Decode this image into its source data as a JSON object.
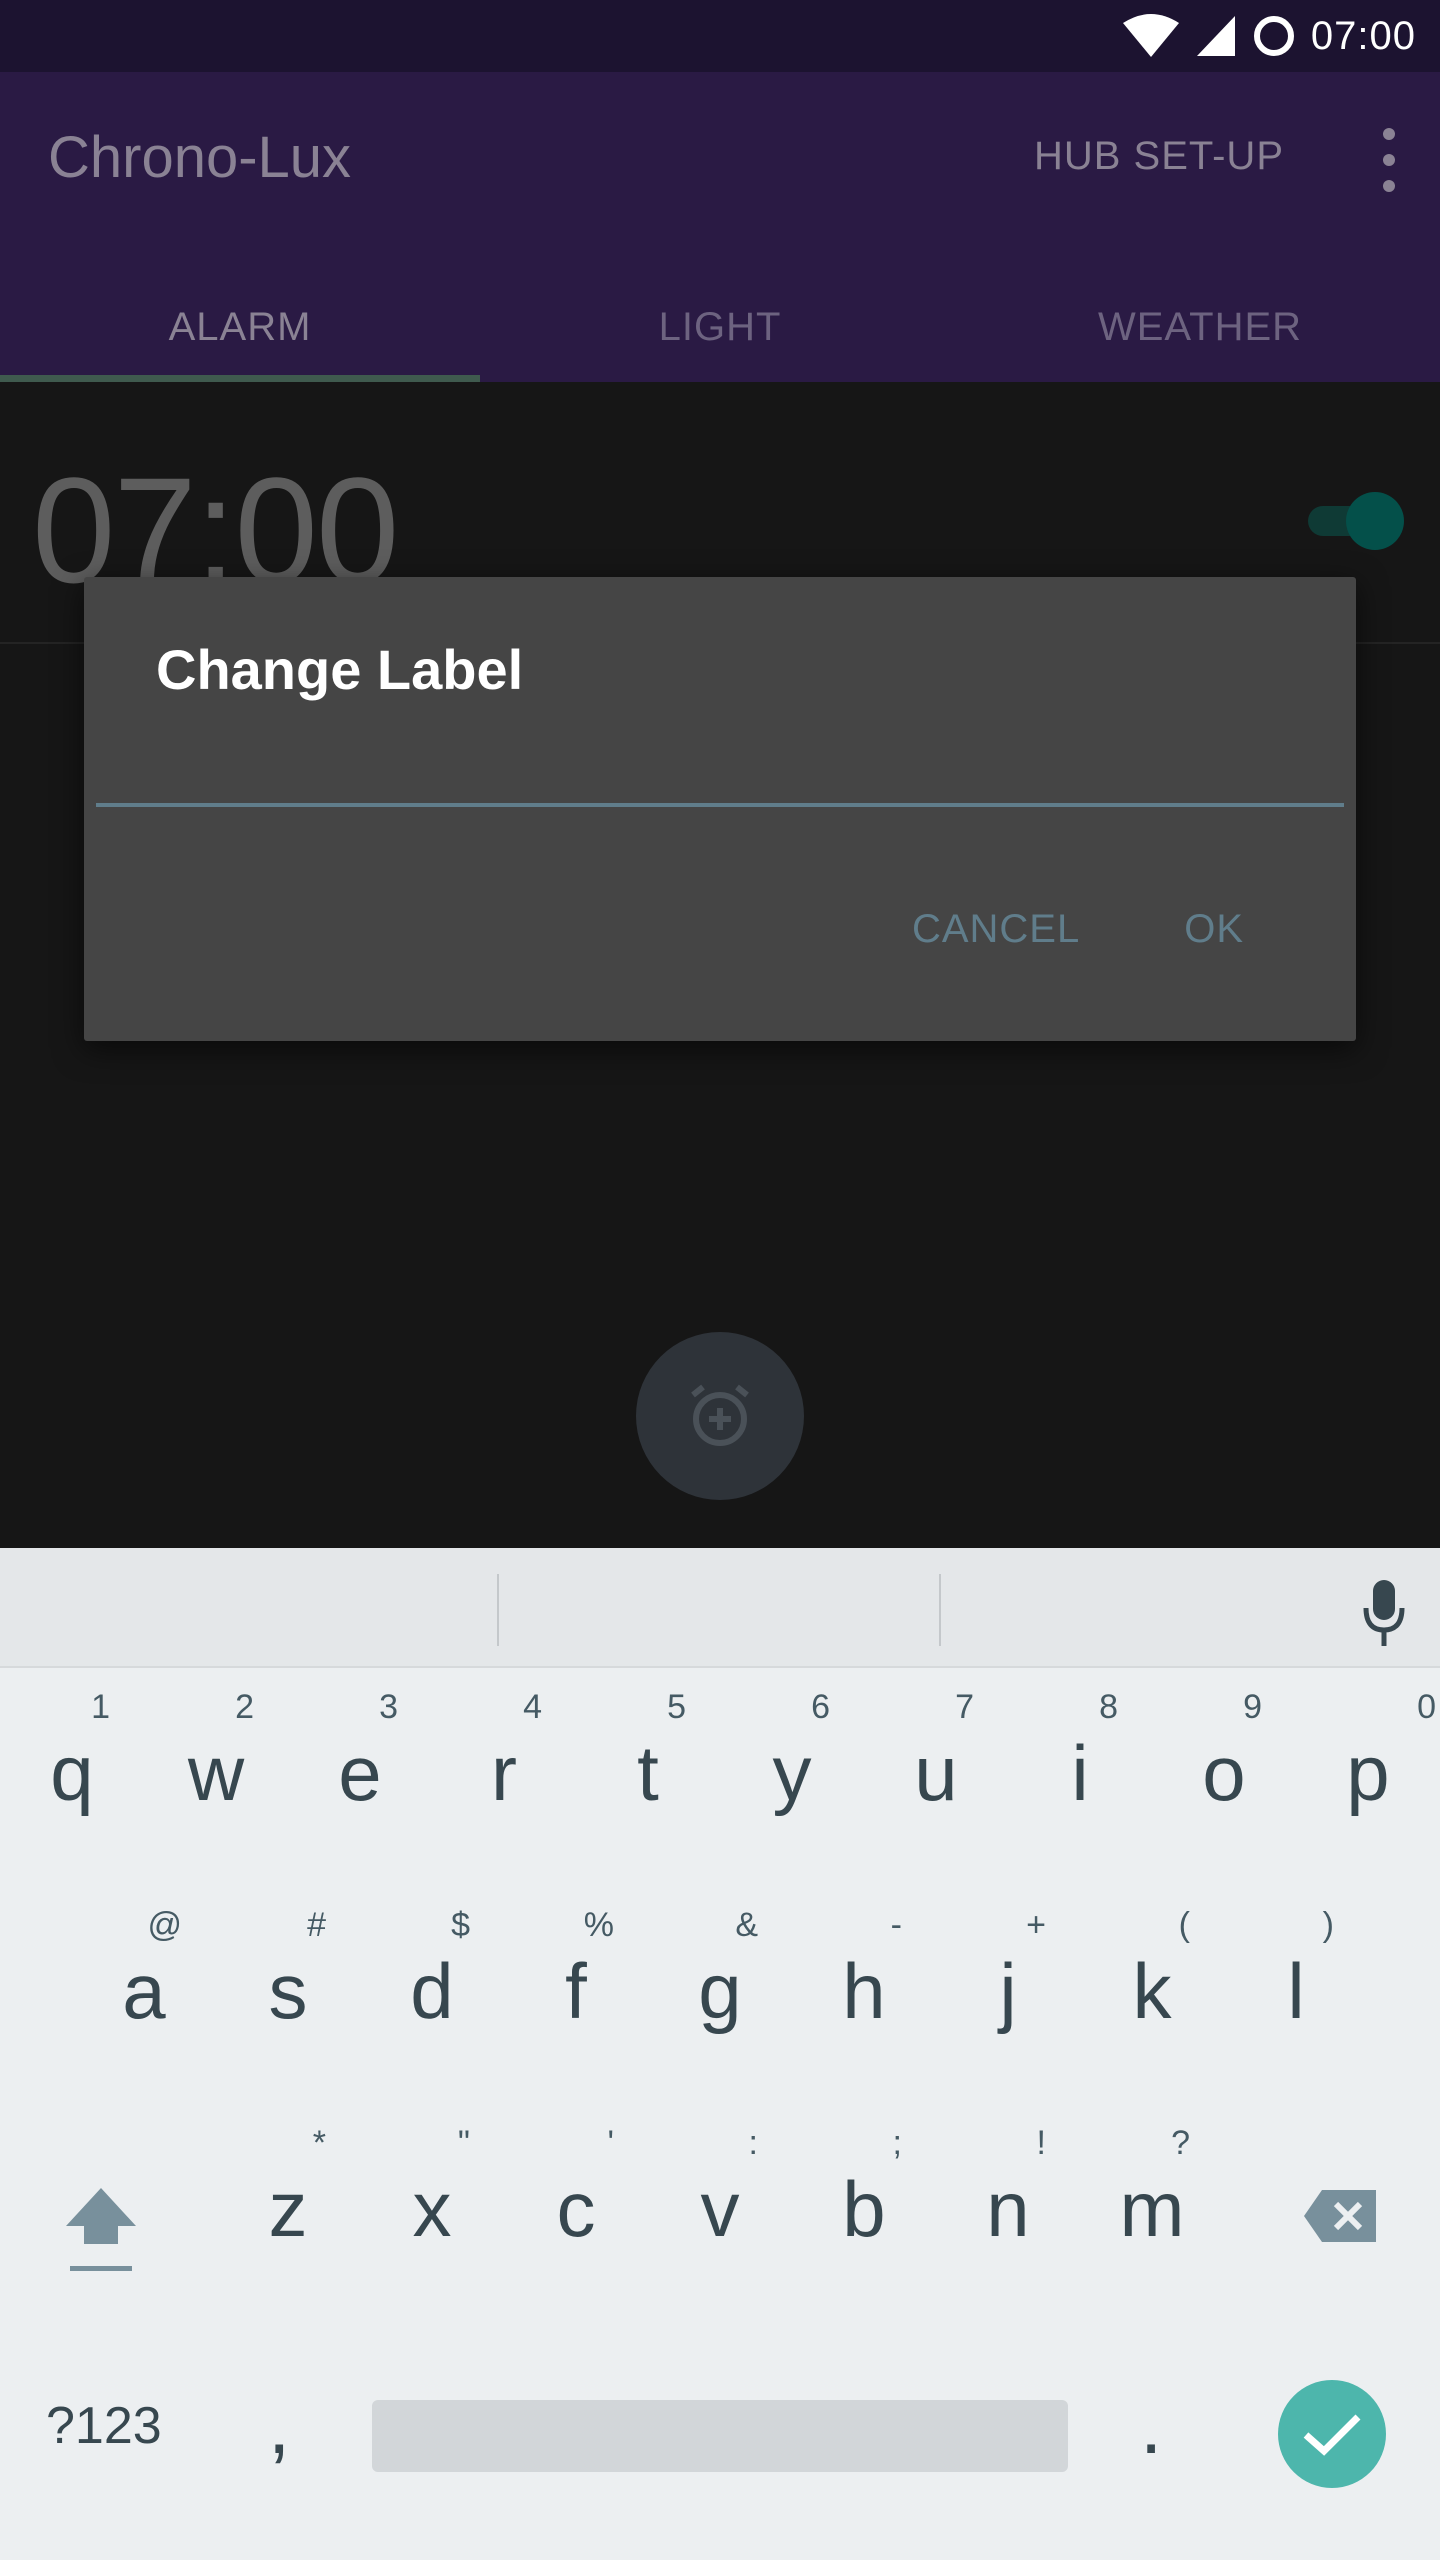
{
  "status_bar": {
    "time": "07:00"
  },
  "app_bar": {
    "title": "Chrono-Lux",
    "hub_setup_label": "HUB SET-UP",
    "more_icon": "more-vert-icon"
  },
  "tabs": [
    {
      "label": "ALARM",
      "active": true
    },
    {
      "label": "LIGHT",
      "active": false
    },
    {
      "label": "WEATHER",
      "active": false
    }
  ],
  "alarm": {
    "time": "07:00",
    "enabled": true
  },
  "fab": {
    "icon": "add-alarm-icon"
  },
  "dialog": {
    "title": "Change Label",
    "input_value": "",
    "cancel_label": "CANCEL",
    "ok_label": "OK"
  },
  "keyboard": {
    "row1": [
      {
        "key": "q",
        "hint": "1"
      },
      {
        "key": "w",
        "hint": "2"
      },
      {
        "key": "e",
        "hint": "3"
      },
      {
        "key": "r",
        "hint": "4"
      },
      {
        "key": "t",
        "hint": "5"
      },
      {
        "key": "y",
        "hint": "6"
      },
      {
        "key": "u",
        "hint": "7"
      },
      {
        "key": "i",
        "hint": "8"
      },
      {
        "key": "o",
        "hint": "9"
      },
      {
        "key": "p",
        "hint": "0"
      }
    ],
    "row2": [
      {
        "key": "a",
        "hint": "@"
      },
      {
        "key": "s",
        "hint": "#"
      },
      {
        "key": "d",
        "hint": "$"
      },
      {
        "key": "f",
        "hint": "%"
      },
      {
        "key": "g",
        "hint": "&"
      },
      {
        "key": "h",
        "hint": "-"
      },
      {
        "key": "j",
        "hint": "+"
      },
      {
        "key": "k",
        "hint": "("
      },
      {
        "key": "l",
        "hint": ")"
      }
    ],
    "row3": [
      {
        "key": "z",
        "hint": "*"
      },
      {
        "key": "x",
        "hint": "\""
      },
      {
        "key": "c",
        "hint": "'"
      },
      {
        "key": "v",
        "hint": ":"
      },
      {
        "key": "b",
        "hint": ";"
      },
      {
        "key": "n",
        "hint": "!"
      },
      {
        "key": "m",
        "hint": "?"
      }
    ],
    "symbols_label": "?123",
    "comma": ",",
    "period": ".",
    "accent_color": "#4db6ac"
  }
}
